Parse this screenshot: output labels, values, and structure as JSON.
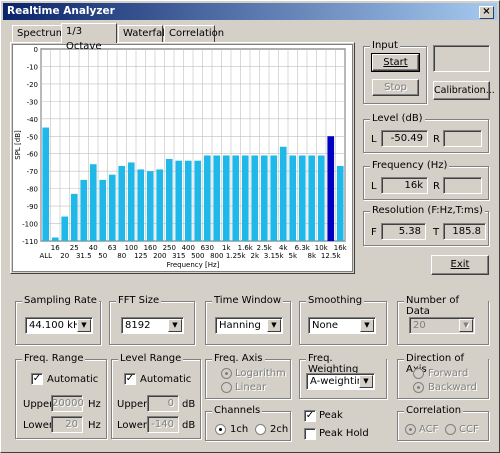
{
  "window": {
    "title": "Realtime Analyzer",
    "close_glyph": "×"
  },
  "tabs": [
    "Spectrum",
    "1/3 Octave",
    "Waterfall",
    "Correlation"
  ],
  "active_tab": 1,
  "chart_data": {
    "type": "bar",
    "ylabel": "SPL [dB]",
    "xlabel": "Frequency [Hz]",
    "ylim": [
      -110,
      0
    ],
    "yticks": [
      "0",
      "-10",
      "-20",
      "-30",
      "-40",
      "-50",
      "-60",
      "-70",
      "-80",
      "-90",
      "-100",
      "-110"
    ],
    "categories": [
      "ALL",
      "20",
      "25",
      "31.5",
      "40",
      "50",
      "63",
      "80",
      "100",
      "125",
      "160",
      "200",
      "250",
      "315",
      "400",
      "500",
      "630",
      "800",
      "1k",
      "1.25k",
      "1.6k",
      "2k",
      "2.5k",
      "3.15k",
      "4k",
      "5k",
      "6.3k",
      "8k",
      "10k",
      "12.5k",
      "16k",
      "20k"
    ],
    "xlabels_top": [
      "16",
      "25",
      "40",
      "63",
      "100",
      "160",
      "250",
      "400",
      "630",
      "1k",
      "1.6k",
      "2.5k",
      "4k",
      "6.3k",
      "10k",
      "16k"
    ],
    "xlabels_bottom": [
      "ALL",
      "20",
      "31.5",
      "50",
      "80",
      "125",
      "200",
      "315",
      "500",
      "800",
      "1.25k",
      "2k",
      "3.15k",
      "5k",
      "8k",
      "12.5k",
      "20k"
    ],
    "values": [
      -45,
      -108,
      -96,
      -83,
      -75,
      -66,
      -75,
      -72,
      -67,
      -65,
      -69,
      -70,
      -69,
      -63,
      -64,
      -64,
      -64,
      -61,
      -61,
      -61,
      -61,
      -61,
      -61,
      -61,
      -61,
      -56,
      -61,
      -61,
      -61,
      -61,
      -50,
      -67
    ],
    "highlight_index": 30,
    "bar_color": "#1fb8e8",
    "highlight_color": "#0000c0",
    "grid": true
  },
  "input": {
    "label": "Input",
    "start": "Start",
    "stop": "Stop",
    "calibration": "Calibration..."
  },
  "level": {
    "label": "Level (dB)",
    "l_label": "L",
    "l_value": "-50.49",
    "r_label": "R",
    "r_value": ""
  },
  "frequency": {
    "label": "Frequency (Hz)",
    "l_label": "L",
    "l_value": "16k",
    "r_label": "R",
    "r_value": ""
  },
  "resolution": {
    "label": "Resolution (F:Hz,T:ms)",
    "f_label": "F",
    "f_value": "5.38",
    "t_label": "T",
    "t_value": "185.8"
  },
  "exit": "Exit",
  "sampling_rate": {
    "label": "Sampling Rate",
    "value": "44.100 kHz"
  },
  "fft_size": {
    "label": "FFT Size",
    "value": "8192"
  },
  "time_window": {
    "label": "Time Window",
    "value": "Hanning"
  },
  "smoothing": {
    "label": "Smoothing",
    "value": "None"
  },
  "number_of_data": {
    "label": "Number of Data",
    "value": "20"
  },
  "freq_range": {
    "label": "Freq. Range",
    "automatic": "Automatic",
    "upper_label": "Upper",
    "upper_value": "20000",
    "upper_unit": "Hz",
    "lower_label": "Lower",
    "lower_value": "20",
    "lower_unit": "Hz"
  },
  "level_range": {
    "label": "Level Range",
    "automatic": "Automatic",
    "upper_label": "Upper",
    "upper_value": "0",
    "upper_unit": "dB",
    "lower_label": "Lower",
    "lower_value": "-140",
    "lower_unit": "dB"
  },
  "freq_axis": {
    "label": "Freq. Axis",
    "logarithm": "Logarithm",
    "linear": "Linear"
  },
  "freq_weighting": {
    "label": "Freq. Weighting",
    "value": "A-weighting"
  },
  "direction_of_axis": {
    "label": "Direction of Axis",
    "forward": "Forward",
    "backward": "Backward"
  },
  "channels": {
    "label": "Channels",
    "ch1": "1ch",
    "ch2": "2ch"
  },
  "peak": {
    "peak": "Peak",
    "peak_hold": "Peak Hold"
  },
  "correlation": {
    "label": "Correlation",
    "acf": "ACF",
    "ccf": "CCF"
  },
  "check_glyph": "✓",
  "dropdown_glyph": "▼"
}
